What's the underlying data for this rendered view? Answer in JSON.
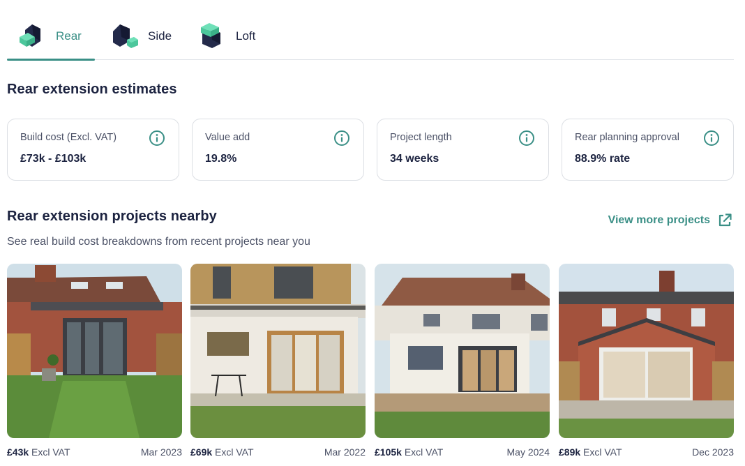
{
  "tabs": [
    {
      "label": "Rear",
      "icon": "rear-extension-icon",
      "active": true
    },
    {
      "label": "Side",
      "icon": "side-extension-icon",
      "active": false
    },
    {
      "label": "Loft",
      "icon": "loft-extension-icon",
      "active": false
    }
  ],
  "colors": {
    "accent": "#3a8f86",
    "text": "#1c2340",
    "muted": "#4b5166",
    "border": "#dcdfe4"
  },
  "estimates": {
    "title": "Rear extension estimates",
    "cards": [
      {
        "label": "Build cost (Excl. VAT)",
        "value": "£73k - £103k",
        "icon": "info-icon"
      },
      {
        "label": "Value add",
        "value": "19.8%",
        "icon": "info-icon"
      },
      {
        "label": "Project length",
        "value": "34 weeks",
        "icon": "info-icon"
      },
      {
        "label": "Rear planning approval",
        "value": "88.9% rate",
        "icon": "info-icon"
      }
    ]
  },
  "projects": {
    "title": "Rear extension projects nearby",
    "subtitle": "See real build cost breakdowns from recent projects near you",
    "view_more": "View more projects",
    "view_more_icon": "external-link-icon",
    "items": [
      {
        "price": "£43k",
        "vat": "Excl VAT",
        "date": "Mar 2023"
      },
      {
        "price": "£69k",
        "vat": "Excl VAT",
        "date": "Mar 2022"
      },
      {
        "price": "£105k",
        "vat": "Excl VAT",
        "date": "May 2024"
      },
      {
        "price": "£89k",
        "vat": "Excl VAT",
        "date": "Dec 2023"
      }
    ]
  }
}
